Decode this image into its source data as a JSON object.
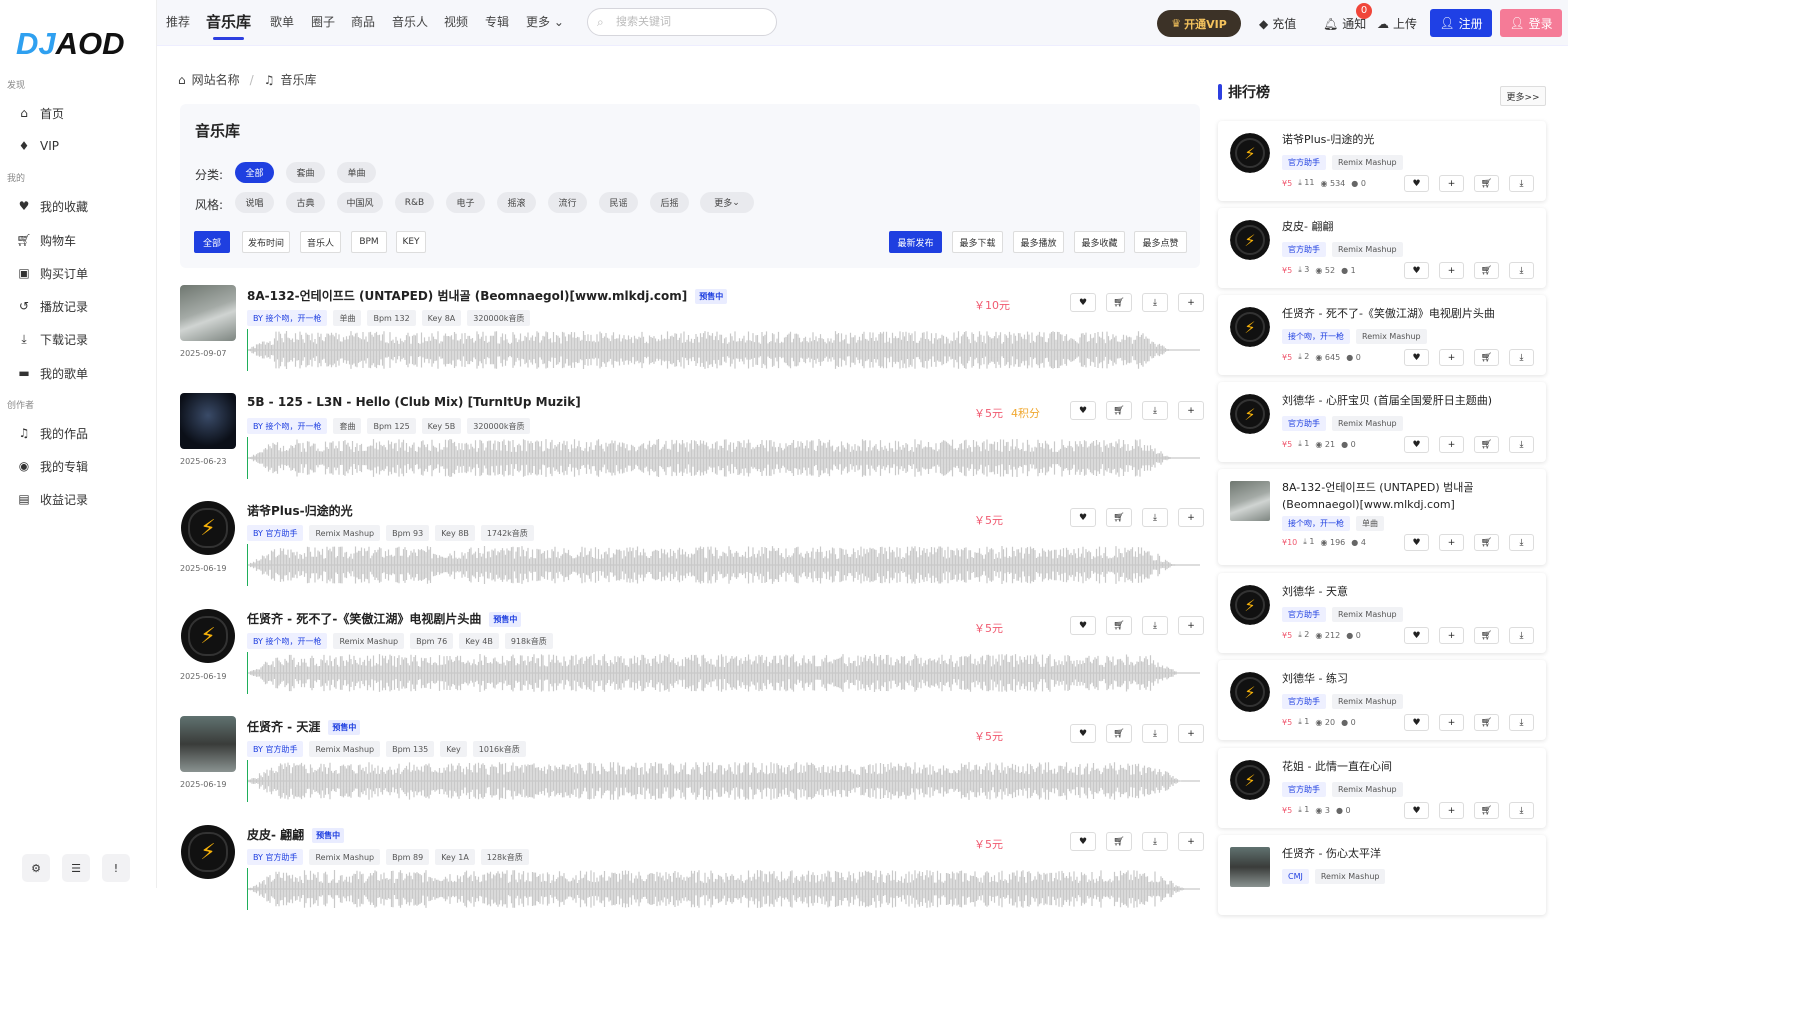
{
  "logo": {
    "part1": "DJ",
    "part2": "AOD"
  },
  "sidebar": {
    "sections": [
      {
        "label": "发现",
        "items": [
          {
            "label": "首页",
            "icon": "home-icon"
          },
          {
            "label": "VIP",
            "icon": "vip-icon"
          }
        ]
      },
      {
        "label": "我的",
        "items": [
          {
            "label": "我的收藏",
            "icon": "heart-icon"
          },
          {
            "label": "购物车",
            "icon": "cart-icon"
          },
          {
            "label": "购买订单",
            "icon": "bag-icon"
          },
          {
            "label": "播放记录",
            "icon": "history-icon"
          },
          {
            "label": "下载记录",
            "icon": "download-icon"
          },
          {
            "label": "我的歌单",
            "icon": "folder-icon"
          }
        ]
      },
      {
        "label": "创作者",
        "items": [
          {
            "label": "我的作品",
            "icon": "music-icon"
          },
          {
            "label": "我的专辑",
            "icon": "album-icon"
          },
          {
            "label": "收益记录",
            "icon": "money-icon"
          }
        ]
      }
    ]
  },
  "topnav": {
    "items": [
      "推荐",
      "音乐库",
      "歌单",
      "圈子",
      "商品",
      "音乐人",
      "视频",
      "专辑",
      "更多"
    ],
    "active": "音乐库"
  },
  "search": {
    "placeholder": "搜索关键词"
  },
  "header": {
    "vip": "开通VIP",
    "recharge": "充值",
    "notify": "通知",
    "notify_count": "0",
    "upload": "上传",
    "register": "注册",
    "login": "登录"
  },
  "breadcrumb": {
    "home": "网站名称",
    "current": "音乐库"
  },
  "filter": {
    "title": "音乐库",
    "category_label": "分类:",
    "categories": [
      "全部",
      "套曲",
      "单曲"
    ],
    "style_label": "风格:",
    "styles": [
      "说唱",
      "古典",
      "中国风",
      "R&B",
      "电子",
      "摇滚",
      "流行",
      "民谣",
      "后摇",
      "更多"
    ],
    "sort_left": [
      "全部",
      "发布时间",
      "音乐人",
      "BPM",
      "KEY"
    ],
    "sort_right": [
      "最新发布",
      "最多下载",
      "最多播放",
      "最多收藏",
      "最多点赞"
    ]
  },
  "tracks": [
    {
      "title": "8A-132-언테이프드 (UNTAPED) 범내골 (Beomnaegol)[www.mlkdj.com]",
      "presale": "预售中",
      "by": "BY 接个吻，开一枪",
      "tags": [
        "单曲",
        "Bpm 132",
        "Key 8A",
        "320000k音质"
      ],
      "price": "￥10元",
      "points": "",
      "date": "2025-09-07",
      "cover": "photo"
    },
    {
      "title": "5B - 125 - L3N - Hello (Club Mix) [TurnItUp Muzik]",
      "presale": "",
      "by": "BY 接个吻，开一枪",
      "tags": [
        "套曲",
        "Bpm 125",
        "Key 5B",
        "320000k音质"
      ],
      "price": "￥5元",
      "points": "4积分",
      "date": "2025-06-23",
      "cover": "hello"
    },
    {
      "title": "诺爷Plus-归途的光",
      "presale": "",
      "by": "BY 官方助手",
      "tags": [
        "Remix Mashup",
        "Bpm 93",
        "Key 8B",
        "1742k音质"
      ],
      "price": "￥5元",
      "points": "",
      "date": "2025-06-19",
      "cover": "disc"
    },
    {
      "title": "任贤齐 - 死不了-《笑傲江湖》电视剧片头曲",
      "presale": "预售中",
      "by": "BY 接个吻，开一枪",
      "tags": [
        "Remix Mashup",
        "Bpm 76",
        "Key 4B",
        "918k音质"
      ],
      "price": "￥5元",
      "points": "",
      "date": "2025-06-19",
      "cover": "disc"
    },
    {
      "title": "任贤齐 - 天涯",
      "presale": "预售中",
      "by": "BY 官方助手",
      "tags": [
        "Remix Mashup",
        "Bpm 135",
        "Key",
        "1016k音质"
      ],
      "price": "￥5元",
      "points": "",
      "date": "2025-06-19",
      "cover": "person"
    },
    {
      "title": "皮皮- 翩翩",
      "presale": "预售中",
      "by": "BY 官方助手",
      "tags": [
        "Remix Mashup",
        "Bpm 89",
        "Key 1A",
        "128k音质"
      ],
      "price": "￥5元",
      "points": "",
      "date": "",
      "cover": "disc"
    }
  ],
  "ranking": {
    "title": "排行榜",
    "more": "更多>>",
    "items": [
      {
        "title": "诺爷Plus-归途的光",
        "by": "官方助手",
        "tag": "Remix Mashup",
        "price": "¥5",
        "downloads": "11",
        "views": "534",
        "comments": "0",
        "cover": "disc"
      },
      {
        "title": "皮皮- 翩翩",
        "by": "官方助手",
        "tag": "Remix Mashup",
        "price": "¥5",
        "downloads": "3",
        "views": "52",
        "comments": "1",
        "cover": "disc"
      },
      {
        "title": "任贤齐 - 死不了-《笑傲江湖》电视剧片头曲",
        "by": "接个吻，开一枪",
        "tag": "Remix Mashup",
        "price": "¥5",
        "downloads": "2",
        "views": "645",
        "comments": "0",
        "cover": "disc"
      },
      {
        "title": "刘德华 - 心肝宝贝 (首届全国爱肝日主题曲)",
        "by": "官方助手",
        "tag": "Remix Mashup",
        "price": "¥5",
        "downloads": "1",
        "views": "21",
        "comments": "0",
        "cover": "disc"
      },
      {
        "title": "8A-132-언테이프드 (UNTAPED) 범내골 (Beomnaegol)[www.mlkdj.com]",
        "by": "接个吻，开一枪",
        "tag": "单曲",
        "price": "¥10",
        "downloads": "1",
        "views": "196",
        "comments": "4",
        "cover": "photo"
      },
      {
        "title": "刘德华 - 天意",
        "by": "官方助手",
        "tag": "Remix Mashup",
        "price": "¥5",
        "downloads": "2",
        "views": "212",
        "comments": "0",
        "cover": "disc"
      },
      {
        "title": "刘德华 - 练习",
        "by": "官方助手",
        "tag": "Remix Mashup",
        "price": "¥5",
        "downloads": "1",
        "views": "20",
        "comments": "0",
        "cover": "disc"
      },
      {
        "title": "花姐 - 此情一直在心间",
        "by": "官方助手",
        "tag": "Remix Mashup",
        "price": "¥5",
        "downloads": "1",
        "views": "3",
        "comments": "0",
        "cover": "disc"
      },
      {
        "title": "任贤齐 - 伤心太平洋",
        "by": "CMJ",
        "tag": "Remix Mashup",
        "price": "",
        "downloads": "",
        "views": "",
        "comments": "",
        "cover": "person"
      }
    ]
  },
  "colors": {
    "accent": "#1f3fe0",
    "price": "#f05a70",
    "vip_gold": "#f4c35d",
    "login": "#f57b97"
  }
}
